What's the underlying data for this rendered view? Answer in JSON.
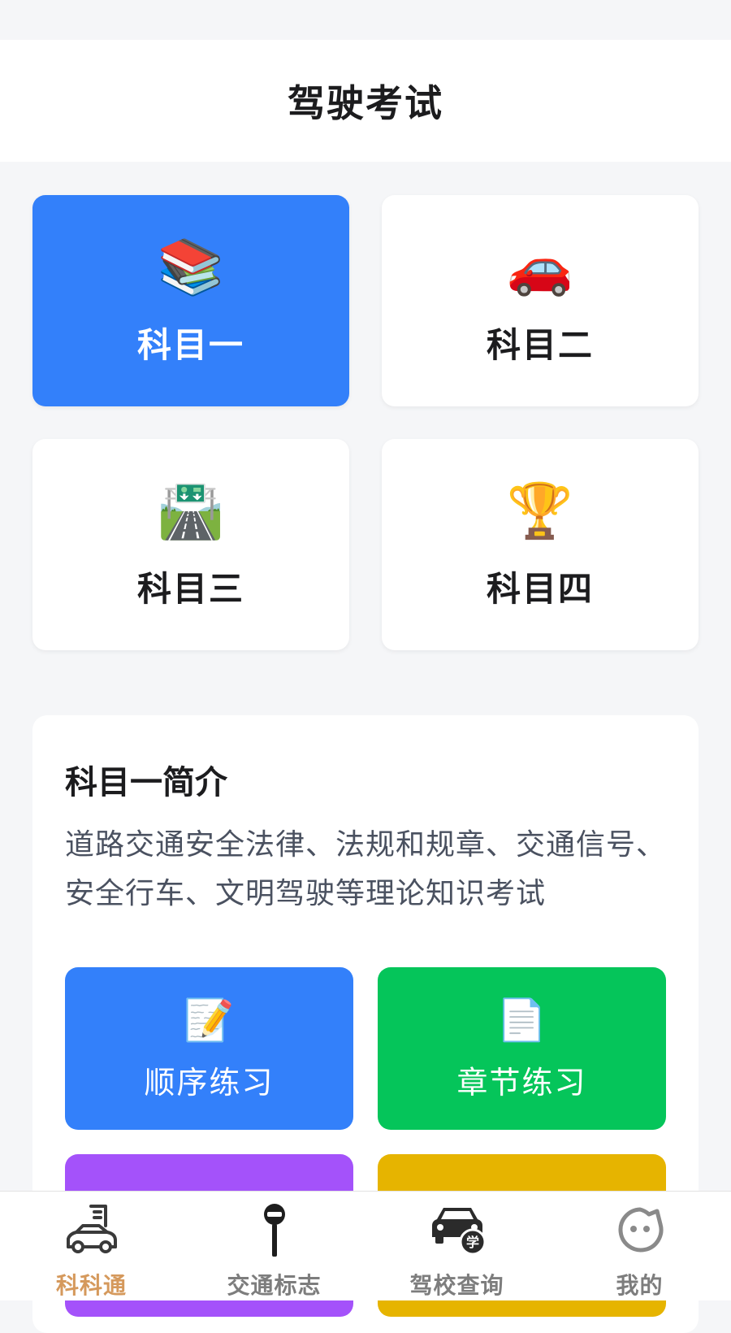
{
  "header": {
    "title": "驾驶考试"
  },
  "subjects": [
    {
      "label": "科目一",
      "icon": "📚",
      "icon_name": "books-icon"
    },
    {
      "label": "科目二",
      "icon": "🚗",
      "icon_name": "car-icon"
    },
    {
      "label": "科目三",
      "icon": "🛣️",
      "icon_name": "highway-icon"
    },
    {
      "label": "科目四",
      "icon": "🏆",
      "icon_name": "trophy-icon"
    }
  ],
  "selected_subject": "科目一",
  "intro": {
    "title": "科目一简介",
    "description": "道路交通安全法律、法规和规章、交通信号、安全行车、文明驾驶等理论知识考试"
  },
  "practice": [
    {
      "label": "顺序练习",
      "icon": "📝",
      "color": "#3380fa"
    },
    {
      "label": "章节练习",
      "icon": "📄",
      "color": "#05c55a"
    },
    {
      "label": "",
      "icon": "",
      "color": "#a452fa"
    },
    {
      "label": "",
      "icon": "",
      "color": "#e6b400"
    }
  ],
  "tabbar": {
    "active": "科科通",
    "items": [
      {
        "label": "科科通",
        "icon_name": "car-learner-icon"
      },
      {
        "label": "交通标志",
        "icon_name": "traffic-sign-icon"
      },
      {
        "label": "驾校查询",
        "icon_name": "driving-school-icon"
      },
      {
        "label": "我的",
        "icon_name": "profile-icon"
      }
    ]
  },
  "colors": {
    "primary": "#3380fa",
    "green": "#05c55a",
    "purple": "#a452fa",
    "yellow": "#e6b400",
    "tab_active": "#d5995c",
    "tab_inactive": "#7d7d7d"
  }
}
